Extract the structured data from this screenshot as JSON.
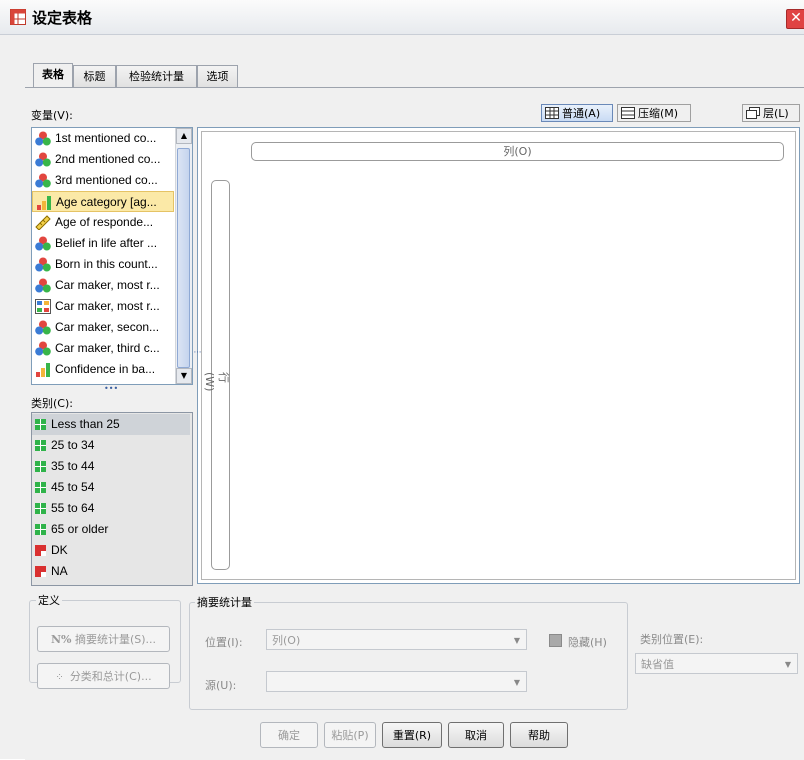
{
  "window": {
    "title": "设定表格",
    "close_glyph": "✕"
  },
  "tabs": [
    {
      "label": "表格"
    },
    {
      "label": "标题"
    },
    {
      "label": "检验统计量"
    },
    {
      "label": "选项"
    }
  ],
  "variables_label": "变量(V):",
  "view_buttons": {
    "normal": "普通(A)",
    "compact": "压缩(M)",
    "layers": "层(L)"
  },
  "variables": [
    {
      "label": "1st mentioned co...",
      "icon": "nominal-icon"
    },
    {
      "label": "2nd mentioned co...",
      "icon": "nominal-icon"
    },
    {
      "label": "3rd mentioned co...",
      "icon": "nominal-icon"
    },
    {
      "label": "Age category [ag...",
      "icon": "ordinal-icon",
      "selected": true
    },
    {
      "label": "Age of responde...",
      "icon": "scale-icon"
    },
    {
      "label": "Belief in life after ...",
      "icon": "nominal-icon"
    },
    {
      "label": "Born in this count...",
      "icon": "nominal-icon"
    },
    {
      "label": "Car maker, most r...",
      "icon": "nominal-icon"
    },
    {
      "label": "Car maker, most r...",
      "icon": "multiple-response-icon"
    },
    {
      "label": "Car maker, secon...",
      "icon": "nominal-icon"
    },
    {
      "label": "Car maker, third c...",
      "icon": "nominal-icon"
    },
    {
      "label": "Confidence in ba...",
      "icon": "ordinal-icon"
    }
  ],
  "splitter": "•••",
  "categories_label": "类别(C):",
  "categories": [
    {
      "label": "Less than 25",
      "type": "valid",
      "selected": true
    },
    {
      "label": "25 to 34",
      "type": "valid"
    },
    {
      "label": "35 to 44",
      "type": "valid"
    },
    {
      "label": "45 to 54",
      "type": "valid"
    },
    {
      "label": "55 to 64",
      "type": "valid"
    },
    {
      "label": "65 or older",
      "type": "valid"
    },
    {
      "label": "DK",
      "type": "missing"
    },
    {
      "label": "NA",
      "type": "missing"
    }
  ],
  "canvas": {
    "columns_label": "列(O)",
    "rows_label": "行(W)"
  },
  "define": {
    "title": "定义",
    "summary_stats_button": "摘要统计量(S)...",
    "summary_stats_prefix": "N%",
    "categories_totals_button": "分类和总计(C)..."
  },
  "summary": {
    "title": "摘要统计量",
    "position_label": "位置(I):",
    "position_value": "列(O)",
    "source_label": "源(U):",
    "source_value": "",
    "hide_label": "隐藏(H)"
  },
  "category_position": {
    "label": "类别位置(E):",
    "value": "缺省值"
  },
  "footer": {
    "ok": "确定",
    "paste": "粘贴(P)",
    "reset": "重置(R)",
    "cancel": "取消",
    "help": "帮助"
  },
  "colors": {
    "selected_var": "#fbe9a7",
    "valid_category": "#2fb34a",
    "missing_category": "#d93030",
    "accent": "#6a89b8"
  }
}
